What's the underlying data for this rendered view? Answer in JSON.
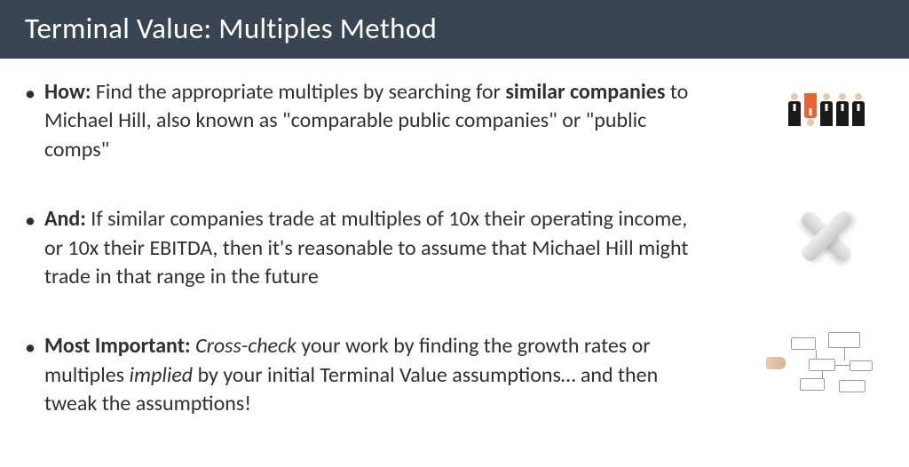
{
  "title": {
    "bold": "Terminal Value:",
    "light": " Multiples Method"
  },
  "bullets": [
    {
      "label": "How:",
      "segments": [
        {
          "text": " Find the appropriate multiples by searching for ",
          "style": ""
        },
        {
          "text": "similar companies",
          "style": "b"
        },
        {
          "text": " to Michael Hill, also known as \"comparable public companies\" or \"public comps\"",
          "style": ""
        }
      ],
      "illustration": "people"
    },
    {
      "label": "And:",
      "segments": [
        {
          "text": " If similar companies trade at multiples of 10x their operating income, or 10x their EBITDA, then it's reasonable to assume that Michael Hill might trade in that range in the future",
          "style": ""
        }
      ],
      "illustration": "x"
    },
    {
      "label": "Most Important:",
      "segments": [
        {
          "text": " ",
          "style": ""
        },
        {
          "text": "Cross-check",
          "style": "i"
        },
        {
          "text": " your work by finding the growth rates or multiples ",
          "style": ""
        },
        {
          "text": "implied",
          "style": "i"
        },
        {
          "text": " by your initial Terminal Value assumptions… and then tweak the assumptions!",
          "style": ""
        }
      ],
      "illustration": "flowchart"
    }
  ]
}
